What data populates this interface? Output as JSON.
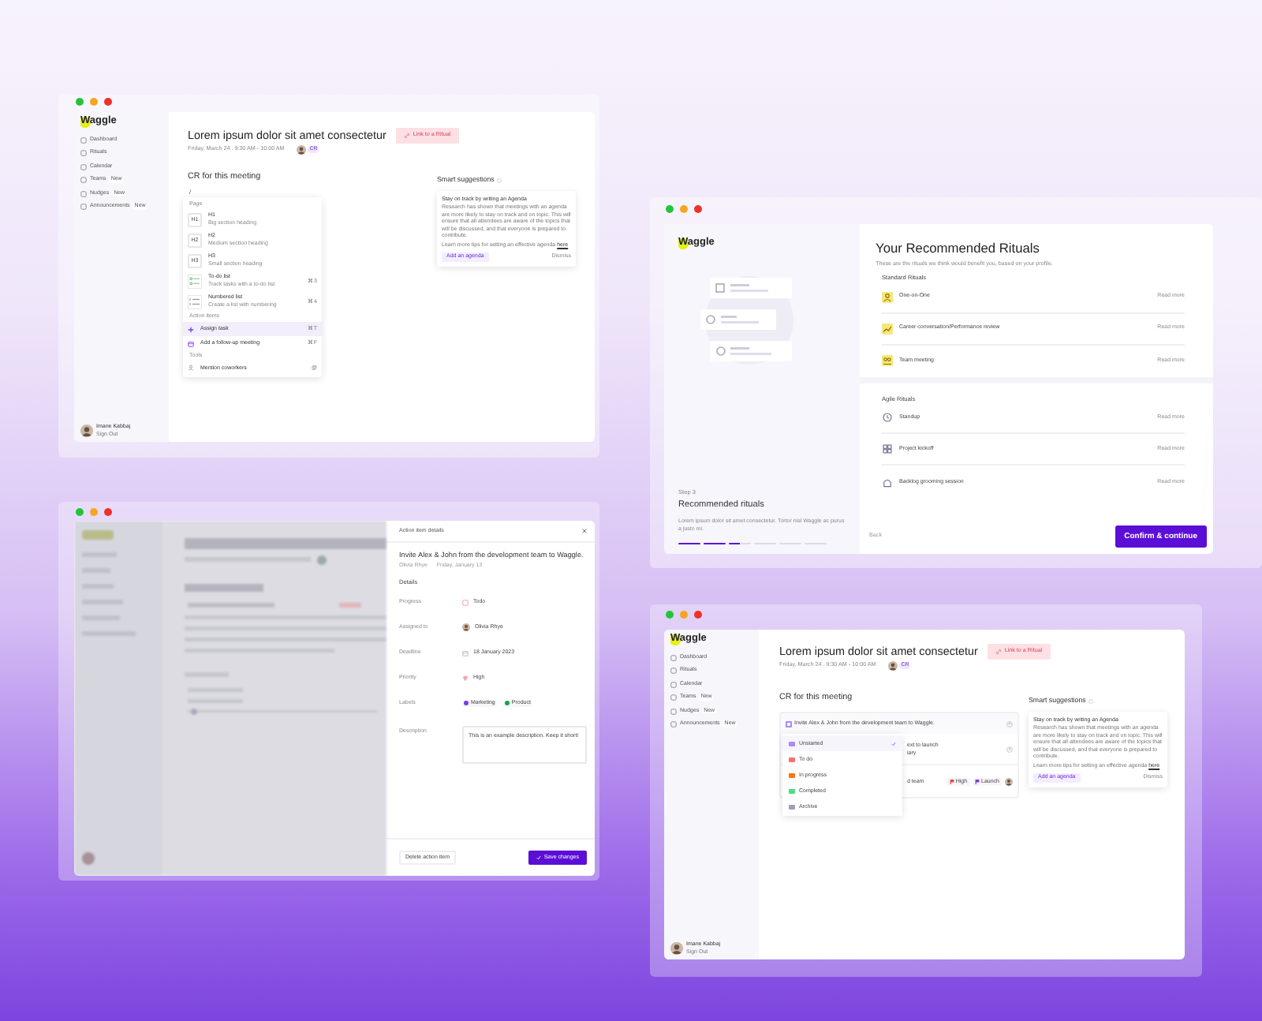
{
  "meeting_window": {
    "sidebar": {
      "logo": "Waggle",
      "items": [
        {
          "label": "Dashboard"
        },
        {
          "label": "Rituals"
        },
        {
          "label": "Calendar"
        },
        {
          "label": "Teams",
          "badge": "New"
        },
        {
          "label": "Nudges",
          "badge": "New"
        },
        {
          "label": "Announcements",
          "badge": "New"
        }
      ],
      "user": {
        "name": "Imane Kabbaj",
        "action": "Sign Out"
      }
    },
    "header": {
      "title": "Lorem ipsum dolor sit amet consectetur",
      "link_button": "Link to a Ritual",
      "date": "Friday, March 24 . 9:30 AM - 10:00 AM",
      "attendee_chip": "CR"
    },
    "section_title": "CR for this meeting",
    "slash": "/",
    "command_menu": [
      {
        "kind": "header",
        "label": "Page"
      },
      {
        "kind": "heading",
        "badge": "H1",
        "label": "H1",
        "hint": "Big section heading",
        "selected": false
      },
      {
        "kind": "heading",
        "badge": "H2",
        "label": "H2",
        "hint": "Medium section heading",
        "selected": false
      },
      {
        "kind": "heading",
        "badge": "H3",
        "label": "H3",
        "hint": "Small section heading",
        "selected": false
      },
      {
        "kind": "todo",
        "label": "To-do list",
        "hint": "Track tasks with a to-do list",
        "shortcut": "⌘3",
        "selected": false
      },
      {
        "kind": "numbered",
        "label": "Numbered list",
        "hint": "Create a list with numbering",
        "shortcut": "⌘4",
        "selected": false
      },
      {
        "kind": "header",
        "label": "Action items"
      },
      {
        "kind": "assign",
        "label": "Assign task",
        "shortcut": "⌘T",
        "selected": true
      },
      {
        "kind": "followup",
        "label": "Add a follow-up meeting",
        "shortcut": "⌘F",
        "selected": false
      },
      {
        "kind": "header",
        "label": "Tools"
      },
      {
        "kind": "mention",
        "label": "Mention coworkers",
        "shortcut": "@",
        "selected": false
      }
    ],
    "smart_suggestions": {
      "title": "Smart suggestions",
      "heading": "Stay on track by writing an Agenda",
      "body": "Research has shown that meetings with an agenda are more likely to stay on track and on topic. This will ensure that all attendees are aware of the topics that will be discussed, and that everyone is prepared to contribute.",
      "tip": "Learn more tips for setting an effective agenda",
      "tip_link": "here",
      "primary": "Add an agenda",
      "secondary": "Dismiss"
    }
  },
  "rituals_window": {
    "logo": "Waggle",
    "step": "Step 3",
    "step_title": "Recommended rituals",
    "step_text": "Lorem ipsum dolor sit amet consectetur. Tortor nisl Waggle ac purus a justo mi.",
    "progress": [
      {
        "level": 1
      },
      {
        "level": 1
      },
      {
        "level": 0.5
      },
      {
        "level": 0
      },
      {
        "level": 0
      },
      {
        "level": 0
      }
    ],
    "title": "Your Recommended Rituals",
    "subtitle": "These are the rituals we think would benefit you, based on your profile.",
    "groups": [
      {
        "title": "Standard Rituals",
        "items": [
          {
            "kind": "one-on-one",
            "label": "One-on-One",
            "link": "Read more"
          },
          {
            "kind": "career",
            "label": "Career conversation/Performance review",
            "link": "Read more"
          },
          {
            "kind": "team",
            "label": "Team meeting",
            "link": "Read more"
          }
        ]
      },
      {
        "title": "Agile Rituals",
        "items": [
          {
            "kind": "standup",
            "label": "Standup",
            "link": "Read more"
          },
          {
            "kind": "kickoff",
            "label": "Project kickoff",
            "link": "Read more"
          },
          {
            "kind": "backlog",
            "label": "Backlog grooming session",
            "link": "Read more"
          }
        ]
      }
    ],
    "back": "Back",
    "confirm": "Confirm & continue"
  },
  "action_item_window": {
    "panel_title": "Action item details",
    "title": "Invite Alex & John from the development team to Waggle.",
    "meta": [
      "Olivia Rhye",
      "Friday, January 13"
    ],
    "details_title": "Details",
    "details": [
      {
        "label": "Progress",
        "kind": "status",
        "value": "Todo"
      },
      {
        "label": "Assigned to",
        "kind": "person",
        "value": "Olivia Rhye"
      },
      {
        "label": "Deadline",
        "kind": "date",
        "value": "18 January 2023"
      },
      {
        "label": "Priority",
        "kind": "priority",
        "value": "High"
      },
      {
        "label": "Labels",
        "kind": "labels",
        "labels": [
          {
            "text": "Marketing",
            "color": "#7c3aed"
          },
          {
            "text": "Product",
            "color": "#16a34a"
          }
        ]
      },
      {
        "label": "Description",
        "kind": "description",
        "value": "This is an example description. Keep it short!"
      }
    ],
    "delete_button": "Delete action item",
    "save_button": "Save changes"
  },
  "status_window": {
    "sidebar": {
      "logo": "Waggle",
      "items": [
        {
          "label": "Dashboard"
        },
        {
          "label": "Rituals"
        },
        {
          "label": "Calendar"
        },
        {
          "label": "Teams",
          "badge": "New"
        },
        {
          "label": "Nudges",
          "badge": "New"
        },
        {
          "label": "Announcements",
          "badge": "New"
        }
      ],
      "user": {
        "name": "Imane Kabbaj",
        "action": "Sign Out"
      }
    },
    "header": {
      "title": "Lorem ipsum dolor sit amet consectetur",
      "link_button": "Link to a Ritual",
      "date": "Friday, March 24 . 9:30 AM - 10:00 AM",
      "attendee_chip": "CR"
    },
    "section_title": "CR for this meeting",
    "action_items": [
      {
        "lines": [
          "Invite Alex & John from the development team to Waggle."
        ]
      },
      {
        "lines": [
          "ext to launch",
          "iary"
        ]
      },
      {
        "lines": [
          "d team"
        ],
        "tags": [
          {
            "text": "High",
            "color": "#e5484d"
          },
          {
            "text": "Launch",
            "color": "#7c3aed"
          }
        ]
      }
    ],
    "status_menu": [
      {
        "label": "Unstarted",
        "color": "#a78bfa",
        "selected": true
      },
      {
        "label": "To do",
        "color": "#f87171",
        "selected": false
      },
      {
        "label": "In progress",
        "color": "#f97316",
        "selected": false
      },
      {
        "label": "Completed",
        "color": "#4ade80",
        "selected": false
      },
      {
        "label": "Archive",
        "color": "#9ca3af",
        "selected": false
      }
    ],
    "smart_suggestions": {
      "title": "Smart suggestions",
      "heading": "Stay on track by writing an Agenda",
      "body": "Research has shown that meetings with an agenda are more likely to stay on track and on topic. This will ensure that all attendees are aware of the topics that will be discussed, and that everyone is prepared to contribute.",
      "tip": "Learn more tips for setting an effective agenda",
      "tip_link": "here",
      "primary": "Add an agenda",
      "secondary": "Dismiss"
    }
  }
}
